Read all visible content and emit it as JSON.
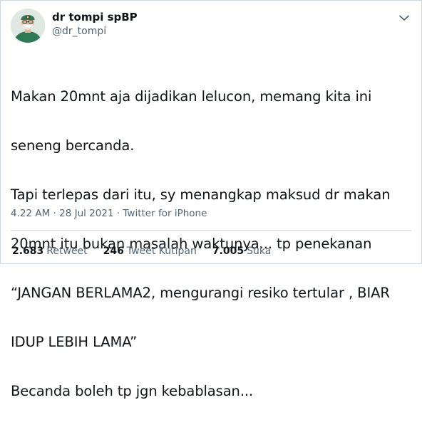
{
  "user": {
    "display_name": "dr tompi spBP",
    "handle": "@dr_tompi"
  },
  "tweet": {
    "lines": [
      "Makan 20mnt aja dijadikan lelucon, memang kita ini",
      "seneng bercanda.",
      "Tapi terlepas dari itu, sy menangkap maksud dr makan",
      "20mnt itu bukan masalah waktunya... tp penekanan",
      "“JANGAN BERLAMA2, mengurangi resiko tertular , BIAR",
      "IDUP LEBIH LAMA”",
      "Becanda boleh tp jgn kebablasan..."
    ]
  },
  "meta": {
    "time": "4.22 AM",
    "separator": "·",
    "date": "28 Jul 2021",
    "client": "Twitter for iPhone"
  },
  "stats": {
    "retweets": {
      "count": "2.683",
      "label": "Retweet"
    },
    "quotes": {
      "count": "246",
      "label": "Tweet Kutipan"
    },
    "likes": {
      "count": "7.005",
      "label": "Suka"
    }
  },
  "icons": {
    "more": "more-options-icon",
    "avatar": "avatar"
  },
  "colors": {
    "text_primary": "#0f1419",
    "text_secondary": "#536471",
    "border": "#cfd9de"
  }
}
